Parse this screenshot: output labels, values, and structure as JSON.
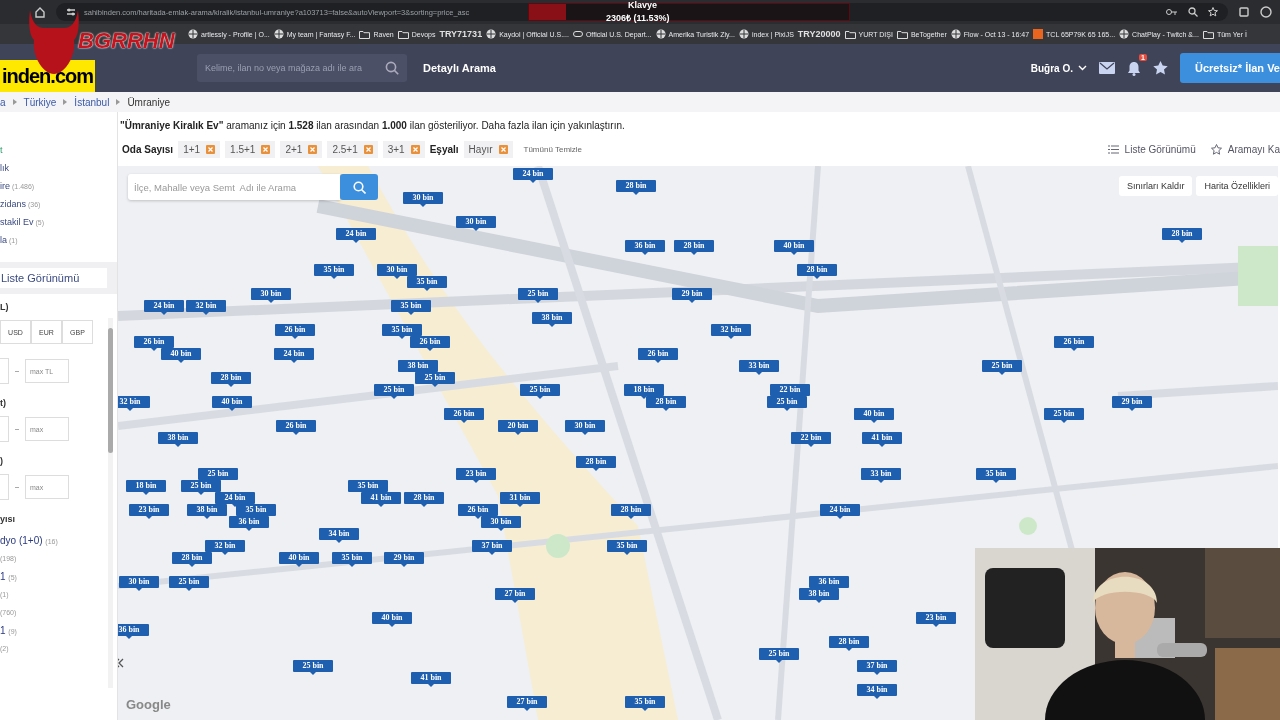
{
  "browser": {
    "url": "sahibinden.com/haritada-emlak-arama/kiralik/istanbul-umraniye?a103713=false&autoViewport=3&sorting=price_asc",
    "bookmarks": [
      {
        "label": "artlessly - Profile | O...",
        "kind": "page"
      },
      {
        "label": "My team | Fantasy F...",
        "kind": "page"
      },
      {
        "label": "Raven",
        "kind": "folder"
      },
      {
        "label": "Devops",
        "kind": "folder"
      },
      {
        "label": "Kaydol | Official U.S....",
        "kind": "page"
      },
      {
        "label": "Official U.S. Depart...",
        "kind": "link"
      },
      {
        "label": "Amerika Turistik Ziy...",
        "kind": "page"
      },
      {
        "label": "index | PixiJS",
        "kind": "page"
      },
      {
        "label": "YURT DIŞI",
        "kind": "folder"
      },
      {
        "label": "BeTogether",
        "kind": "folder"
      },
      {
        "label": "Flow - Oct 13 - 16:47",
        "kind": "page"
      },
      {
        "label": "TCL 65P79K 65 165...",
        "kind": "hb"
      },
      {
        "label": "ChatPlay - Twitch &...",
        "kind": "page"
      },
      {
        "label": "Tüm Yer İ",
        "kind": "folder"
      }
    ]
  },
  "header": {
    "logo": "inden.com",
    "search_placeholder": "Kelime, ilan no veya mağaza adı ile ara",
    "detailed_search": "Detaylı Arama",
    "user": "Buğra O.",
    "notification_count": "1",
    "cta": "Ücretsiz* İlan Ve"
  },
  "breadcrumbs": [
    "a",
    "Türkiye",
    "İstanbul",
    "Ümraniye"
  ],
  "sidebar": {
    "categories": [
      {
        "label": "t",
        "selected": true
      },
      {
        "label": "lık",
        "selected": false
      },
      {
        "label": "ire",
        "count": "(1.486)",
        "selected": false
      },
      {
        "label": "zidans",
        "count": "(36)",
        "selected": false
      },
      {
        "label": "stakil Ev",
        "count": "(5)",
        "selected": false
      },
      {
        "label": "la",
        "count": "(1)",
        "selected": false
      }
    ],
    "list_view": "Liste Görünümü",
    "price_heading": "L)",
    "currencies": [
      "USD",
      "EUR",
      "GBP"
    ],
    "price_max_placeholder": "max TL",
    "ranges": [
      {
        "heading": "t)",
        "max_placeholder": "max"
      },
      {
        "heading": ")",
        "max_placeholder": "max"
      }
    ],
    "rooms_heading": "yısı",
    "rooms": [
      {
        "label": "dyo (1+0)",
        "count": "(16)"
      },
      {
        "count": "(198)"
      },
      {
        "label": "1",
        "count": "(5)"
      },
      {
        "count": "(1)"
      },
      {
        "count": "(760)"
      },
      {
        "label": "1",
        "count": "(9)"
      },
      {
        "count": "(2)"
      }
    ]
  },
  "summary": "**\"Ümraniye Kiralık Ev\"** aramanız için **1.528** ilan arasından **1.000** ilan gösteriliyor. Daha fazla ilan için yakınlaştırın.",
  "filters": [
    {
      "label": "Oda Sayısı",
      "chips": [
        "1+1",
        "1.5+1",
        "2+1",
        "2.5+1",
        "3+1"
      ]
    },
    {
      "label": "Eşyalı",
      "chips": [
        "Hayır"
      ]
    }
  ],
  "clear_all": "Tümünü Temizle",
  "list_view": "Liste Görünümü",
  "save_search": "Aramayı Ka",
  "map": {
    "search_placeholder": "İlçe, Mahalle veya Semt  Adı ile Arama",
    "buttons": [
      "Sınırları Kaldır",
      "Harita Özellikleri"
    ],
    "attribution": "Google",
    "markers": [
      "24 bin",
      "28 bin",
      "30 bin",
      "30 bin",
      "24 bin",
      "28 bin",
      "36 bin",
      "28 bin",
      "40 bin",
      "35 bin",
      "30 bin",
      "28 bin",
      "35 bin",
      "30 bin",
      "25 bin",
      "29 bin",
      "24 bin",
      "32 bin",
      "35 bin",
      "38 bin",
      "26 bin",
      "35 bin",
      "32 bin",
      "26 bin",
      "26 bin",
      "26 bin",
      "40 bin",
      "24 bin",
      "26 bin",
      "38 bin",
      "33 bin",
      "25 bin",
      "28 bin",
      "25 bin",
      "25 bin",
      "25 bin",
      "18 bin",
      "22 bin",
      "32 bin",
      "40 bin",
      "28 bin",
      "25 bin",
      "29 bin",
      "26 bin",
      "40 bin",
      "25 bin",
      "26 bin",
      "20 bin",
      "30 bin",
      "38 bin",
      "22 bin",
      "41 bin",
      "28 bin",
      "25 bin",
      "23 bin",
      "33 bin",
      "35 bin",
      "18 bin",
      "25 bin",
      "35 bin",
      "24 bin",
      "41 bin",
      "28 bin",
      "31 bin",
      "23 bin",
      "38 bin",
      "35 bin",
      "26 bin",
      "28 bin",
      "24 bin",
      "36 bin",
      "30 bin",
      "34 bin",
      "32 bin",
      "37 bin",
      "35 bin",
      "28 bin",
      "40 bin",
      "35 bin",
      "29 bin",
      "30 bin",
      "25 bin",
      "36 bin",
      "27 bin",
      "38 bin",
      "40 bin",
      "23 bin",
      "36 bin",
      "28 bin",
      "25 bin",
      "25 bin",
      "37 bin",
      "41 bin",
      "34 bin",
      "27 bin",
      "35 bin"
    ]
  },
  "stream_overlay": {
    "logo": "BGRRHN",
    "title": "Klavye",
    "progress": "2306₺ (11.53%)",
    "level": 0.1153,
    "left_total": "TRY71731",
    "right_total": "TRY20000"
  }
}
